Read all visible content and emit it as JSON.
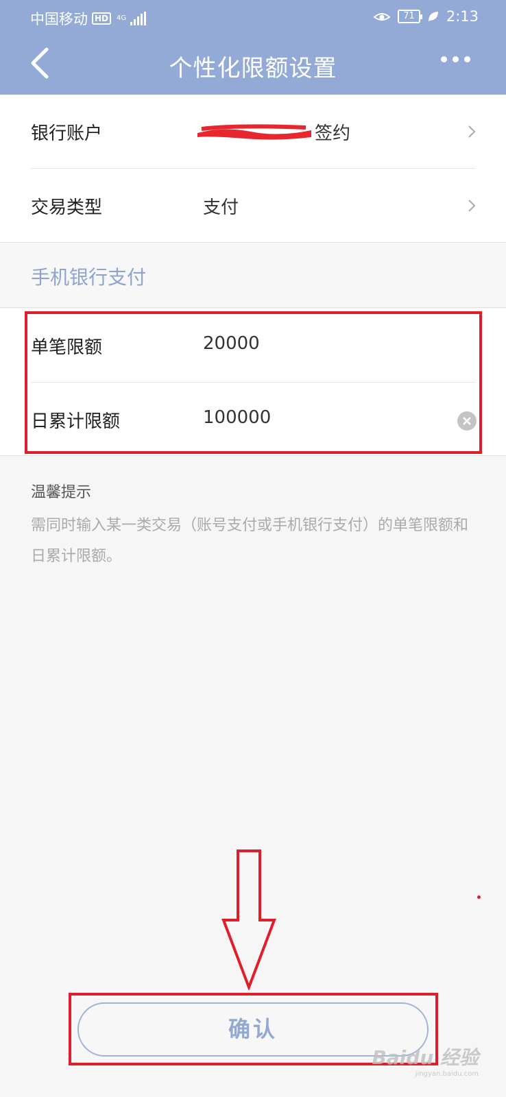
{
  "status_bar": {
    "carrier": "中国移动",
    "hd": "HD",
    "network": "4G",
    "battery": "71",
    "time": "2:13"
  },
  "header": {
    "title": "个性化限额设置"
  },
  "account_section": {
    "bank_account_label": "银行账户",
    "bank_account_suffix": "签约",
    "trade_type_label": "交易类型",
    "trade_type_value": "支付"
  },
  "mobile_section": {
    "title": "手机银行支付",
    "single_limit_label": "单笔限额",
    "single_limit_value": "20000",
    "daily_limit_label": "日累计限额",
    "daily_limit_value": "100000"
  },
  "tips": {
    "title": "温馨提示",
    "body": "需同时输入某一类交易（账号支付或手机银行支付）的单笔限额和日累计限额。"
  },
  "confirm_label": "确认",
  "watermark": {
    "text": "Baidu 经验",
    "sub": "jingyan.baidu.com"
  },
  "colors": {
    "header_bg": "#93aad6",
    "accent": "#8ea4cf",
    "highlight": "#e01e2b"
  }
}
